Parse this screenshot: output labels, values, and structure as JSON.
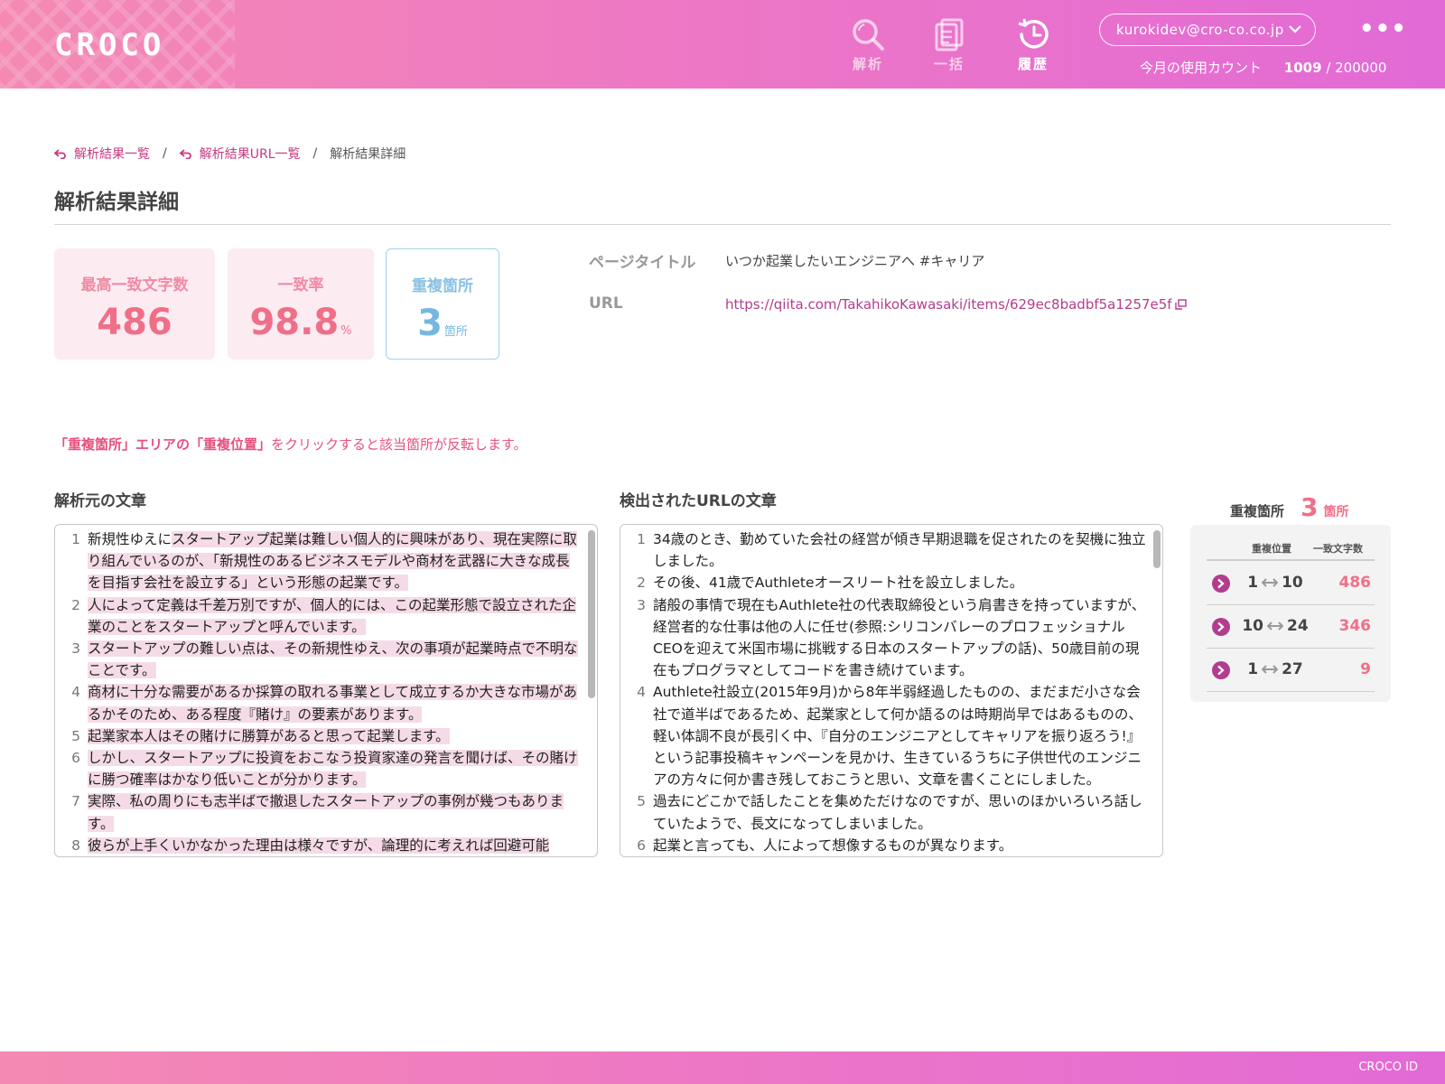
{
  "header": {
    "logo": "CROCO",
    "nav": [
      {
        "label": "解析",
        "icon": "search-icon",
        "active": false
      },
      {
        "label": "一括",
        "icon": "batch-icon",
        "active": false
      },
      {
        "label": "履歴",
        "icon": "history-icon",
        "active": true
      }
    ],
    "user_email": "kurokidev@cro-co.co.jp",
    "more_label": "•••",
    "usage_label": "今月の使用カウント",
    "usage_used": "1009",
    "usage_sep": " / ",
    "usage_limit": "200000"
  },
  "breadcrumb": {
    "items": [
      "解析結果一覧",
      "解析結果URL一覧"
    ],
    "separator": "/",
    "current": "解析結果詳細"
  },
  "page_title": "解析結果詳細",
  "stats": [
    {
      "label": "最高一致文字数",
      "value": "486",
      "unit": ""
    },
    {
      "label": "一致率",
      "value": "98.8",
      "unit": "%"
    },
    {
      "label": "重複箇所",
      "value": "3",
      "unit": "箇所"
    }
  ],
  "page_info": {
    "title_label": "ページタイトル",
    "title_value": "いつか起業したいエンジニアへ #キャリア",
    "url_label": "URL",
    "url_value": "https://qiita.com/TakahikoKawasaki/items/629ec8badbf5a1257e5f"
  },
  "hint": {
    "part1": "「重複箇所」エリアの「重複位置」",
    "part2": "をクリックすると該当箇所が反転します。"
  },
  "source": {
    "title": "解析元の文章",
    "lines": [
      {
        "num": "1",
        "plain": "新規性ゆえに",
        "hl": "スタートアップ起業は難しい個人的に興味があり、現在実際に取り組んでいるのが、「新規性のあるビジネスモデルや商材を武器に大きな成長を目指す会社を設立する」という形態の起業です。"
      },
      {
        "num": "2",
        "plain": "",
        "hl": "人によって定義は千差万別ですが、個人的には、この起業形態で設立された企業のことをスタートアップと呼んでいます。"
      },
      {
        "num": "3",
        "plain": "",
        "hl": "スタートアップの難しい点は、その新規性ゆえ、次の事項が起業時点で不明なことです。"
      },
      {
        "num": "4",
        "plain": "",
        "hl": "商材に十分な需要があるか採算の取れる事業として成立するか大きな市場があるかそのため、ある程度『賭け』の要素があります。"
      },
      {
        "num": "5",
        "plain": "",
        "hl": "起業家本人はその賭けに勝算があると思って起業します。"
      },
      {
        "num": "6",
        "plain": "",
        "hl": "しかし、スタートアップに投資をおこなう投資家達の発言を聞けば、その賭けに勝つ確率はかなり低いことが分かります。"
      },
      {
        "num": "7",
        "plain": "",
        "hl": "実際、私の周りにも志半ばで撤退したスタートアップの事例が幾つもあります。"
      },
      {
        "num": "8",
        "plain": "",
        "hl": "彼らが上手くいかなかった理由は様々ですが、論理的に考えれば回避可能"
      }
    ]
  },
  "detected": {
    "title": "検出されたURLの文章",
    "lines": [
      {
        "num": "1",
        "text": "34歳のとき、勤めていた会社の経営が傾き早期退職を促されたのを契機に独立しました。"
      },
      {
        "num": "2",
        "text": "その後、41歳でAuthleteオースリート社を設立しました。"
      },
      {
        "num": "3",
        "text": "諸般の事情で現在もAuthlete社の代表取締役という肩書きを持っていますが、経営者的な仕事は他の人に任せ(参照:シリコンバレーのプロフェッショナルCEOを迎えて米国市場に挑戦する日本のスタートアップの話)、50歳目前の現在もプログラマとしてコードを書き続けています。"
      },
      {
        "num": "4",
        "text": "Authlete社設立(2015年9月)から8年半弱経過したものの、まだまだ小さな会社で道半ばであるため、起業家として何か語るのは時期尚早ではあるものの、軽い体調不良が長引く中、『自分のエンジニアとしてキャリアを振り返ろう!』という記事投稿キャンペーンを見かけ、生きているうちに子供世代のエンジニアの方々に何か書き残しておこうと思い、文章を書くことにしました。"
      },
      {
        "num": "5",
        "text": "過去にどこかで話したことを集めただけなのですが、思いのほかいろいろ話していたようで、長文になってしまいました。"
      },
      {
        "num": "6",
        "text": "起業と言っても、人によって想像するものが異なります。"
      }
    ]
  },
  "duplicates": {
    "title": "重複箇所",
    "count": "3",
    "unit": "箇所",
    "col_position": "重複位置",
    "col_chars": "一致文字数",
    "rows": [
      {
        "from": "1",
        "to": "10",
        "chars": "486"
      },
      {
        "from": "10",
        "to": "24",
        "chars": "346"
      },
      {
        "from": "1",
        "to": "27",
        "chars": "9"
      }
    ]
  },
  "footer": {
    "text": "CROCO ID"
  },
  "colors": {
    "accent": "#b23d8e",
    "stat_pink": "#f06f88",
    "stat_blue": "#74b8e0",
    "highlight": "#f5dbe7"
  }
}
